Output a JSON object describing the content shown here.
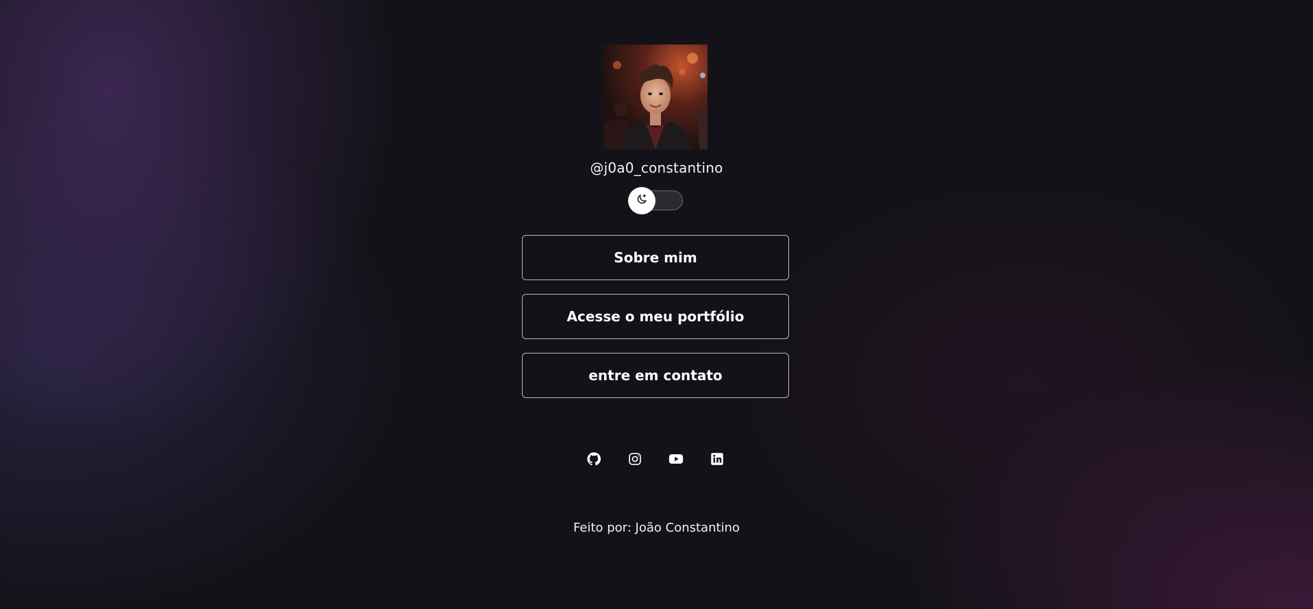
{
  "profile": {
    "username": "@j0a0_constantino"
  },
  "theme_toggle": {
    "icon": "moon-sparkle-icon",
    "state": "dark"
  },
  "links": [
    {
      "label": "Sobre mim"
    },
    {
      "label": "Acesse o meu portfólio"
    },
    {
      "label": "entre em contato"
    }
  ],
  "socials": [
    {
      "icon": "github-icon"
    },
    {
      "icon": "instagram-icon"
    },
    {
      "icon": "youtube-icon"
    },
    {
      "icon": "linkedin-icon"
    }
  ],
  "footer": {
    "text": "Feito por: João Constantino"
  }
}
